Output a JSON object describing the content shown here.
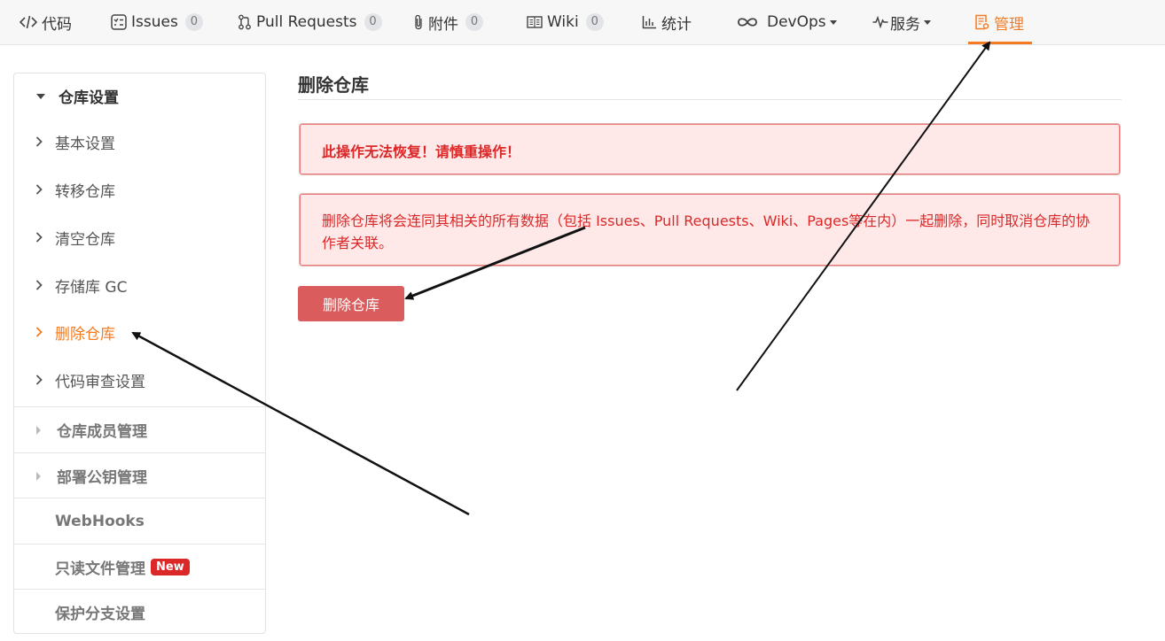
{
  "nav": {
    "tabs": [
      {
        "label": "代码",
        "icon": "code-icon"
      },
      {
        "label": "Issues",
        "count": "0",
        "icon": "issues-icon"
      },
      {
        "label": "Pull Requests",
        "count": "0",
        "icon": "pull-request-icon"
      },
      {
        "label": "附件",
        "count": "0",
        "icon": "paperclip-icon"
      },
      {
        "label": "Wiki",
        "count": "0",
        "icon": "book-icon"
      },
      {
        "label": "统计",
        "icon": "bar-chart-icon"
      },
      {
        "label": "DevOps",
        "icon": "infinity-icon"
      },
      {
        "label": "服务",
        "icon": "pulse-icon"
      },
      {
        "label": "管理",
        "icon": "settings-doc-icon",
        "active": true
      }
    ]
  },
  "sidebar": {
    "group_repo_settings": "仓库设置",
    "items": [
      {
        "label": "基本设置"
      },
      {
        "label": "转移仓库"
      },
      {
        "label": "清空仓库"
      },
      {
        "label": "存储库 GC"
      },
      {
        "label": "删除仓库",
        "active": true
      },
      {
        "label": "代码审查设置"
      }
    ],
    "group_members": "仓库成员管理",
    "group_deploy_keys": "部署公钥管理",
    "webhooks": "WebHooks",
    "readonly_files": "只读文件管理",
    "new_badge": "New",
    "branch_protection": "保护分支设置"
  },
  "main": {
    "title": "删除仓库",
    "warning": "此操作无法恢复！请慎重操作！",
    "description": "删除仓库将会连同其相关的所有数据（包括 Issues、Pull Requests、Wiki、Pages等在内）一起删除，同时取消仓库的协作者关联。",
    "delete_button": "删除仓库"
  },
  "colors": {
    "accent": "#f57b22",
    "danger": "#db2828",
    "danger_bg": "#ffe8e8",
    "button": "#db5c5c"
  }
}
